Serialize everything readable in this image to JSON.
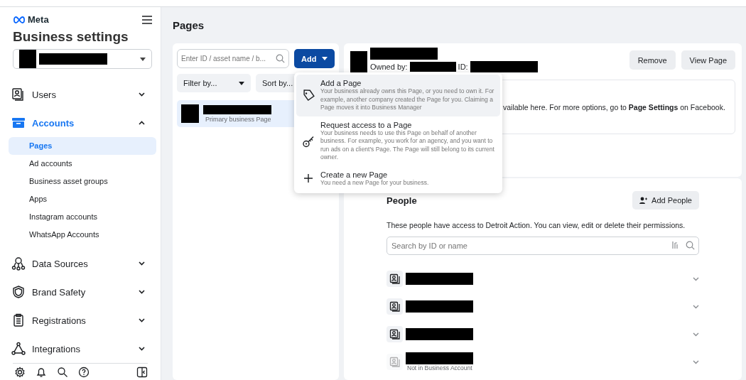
{
  "sidebar": {
    "brand": "Meta",
    "title": "Business settings",
    "nav": [
      {
        "label": "Users",
        "active": false,
        "expanded": false
      },
      {
        "label": "Accounts",
        "active": true,
        "expanded": true,
        "children": [
          {
            "label": "Pages",
            "selected": true
          },
          {
            "label": "Ad accounts",
            "selected": false
          },
          {
            "label": "Business asset groups",
            "selected": false
          },
          {
            "label": "Apps",
            "selected": false
          },
          {
            "label": "Instagram accounts",
            "selected": false
          },
          {
            "label": "WhatsApp Accounts",
            "selected": false
          }
        ]
      },
      {
        "label": "Data Sources",
        "active": false,
        "expanded": false
      },
      {
        "label": "Brand Safety",
        "active": false,
        "expanded": false
      },
      {
        "label": "Registrations",
        "active": false,
        "expanded": false
      },
      {
        "label": "Integrations",
        "active": false,
        "expanded": false
      }
    ]
  },
  "main": {
    "title": "Pages",
    "list_panel": {
      "search": {
        "placeholder": "Enter ID / asset name / b..."
      },
      "add_button": "Add",
      "filter": "Filter by...",
      "sort": "Sort by...",
      "items": [
        {
          "subtitle": "Primary business Page",
          "selected": true
        }
      ]
    },
    "add_menu": {
      "items": [
        {
          "title": "Add a Page",
          "description": "Your business already owns this Page, or you need to own it. For example, another company created the Page for you. Claiming a Page moves it into Business Manager",
          "highlighted": true
        },
        {
          "title": "Request access to a Page",
          "description": "Your business needs to use this Page on behalf of another business. For example, you work for an agency, and you want to run ads on a client's Page. The Page will still belong to its current owner.",
          "highlighted": false
        },
        {
          "title": "Create a new Page",
          "description": "You need a new Page for your business.",
          "highlighted": false
        }
      ]
    },
    "detail": {
      "owned_by_label": "Owned by:",
      "id_label": "ID:",
      "buttons": [
        "Remove",
        "View Page"
      ],
      "notice": "vailable here. For more options, go to **Page Settings** on Facebook.",
      "people": {
        "title": "People",
        "add_button": "Add People",
        "description": "These people have access to Detroit Action. You can view, edit or delete their permissions.",
        "search": {
          "placeholder": "Search by ID or name"
        },
        "rows": [
          {
            "in_business": true
          },
          {
            "in_business": true
          },
          {
            "in_business": true
          },
          {
            "in_business": false,
            "note": "Not in Business Account"
          }
        ]
      }
    }
  }
}
